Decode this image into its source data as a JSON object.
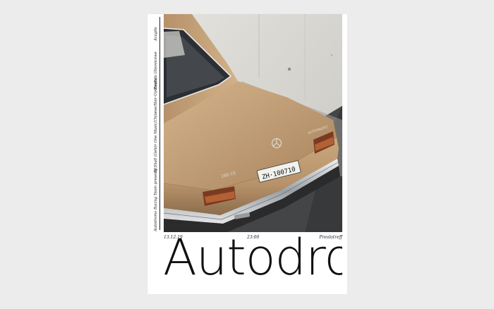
{
  "poster": {
    "side_texts": [
      "Autodromo Racing Team presents:",
      "DJ Shall (Gehör One Music/Chinese/Hair-Up-Beats)",
      "Stephan Glisovicewe",
      "Acagila"
    ],
    "date": "13.12.19",
    "time": "23:00",
    "venue": "Preolotreff",
    "title": "Autodromo",
    "plate": "ZH·100710",
    "badge": "280 CE",
    "trunk_script": "AUTOMATIC"
  },
  "colors": {
    "background": "#ececec",
    "paper": "#ffffff",
    "car_body": "#c9a57a",
    "concrete": "#d6d4cf",
    "asphalt": "#3f3f40",
    "ink": "#111111"
  }
}
